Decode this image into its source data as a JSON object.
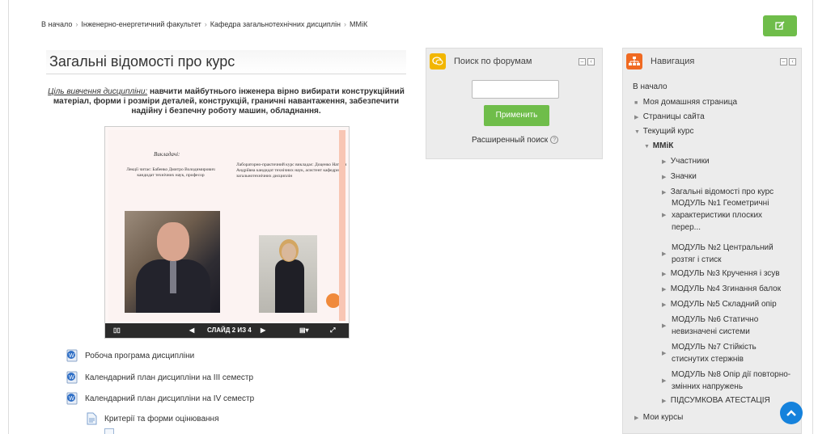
{
  "breadcrumb": [
    "В начало",
    "Інженерно-енергетичний факультет",
    "Кафедра загальнотехнічних дисциплін",
    "ММіК"
  ],
  "colors": {
    "accent_green": "#6fbd4a",
    "nav_orange": "#f06a22",
    "search_yellow": "#f2b600",
    "scroll_blue": "#1582dc"
  },
  "main": {
    "title": "Загальні відомості про курс",
    "intro_lead": "Ціль вивчення дисципліни:",
    "intro_text": " навчити майбутнього інженера вірно вибирати конструкційний матеріал, форми і розміри деталей, конструкцій, граничні навантаження, забезпечити надійну і безпечну роботу машин, обладнання.",
    "slide": {
      "heading": "Викладачі:",
      "left_text": "Лекції читає: Бабенко Дмитро Володимирович кандидат технічних наук, професор",
      "right_text": "Лабораторно-практичний курс викладає: Доценко Наталія Андріївна кандидат технічних наук, асистент кафедри загальнотехнічних дисциплін",
      "counter": "СЛАЙД 2 ИЗ 4"
    },
    "resources": [
      "Робоча програма дисципліни",
      "Календарний план дисципліни на ІІІ семестр",
      "Календарний план дисципліни на IV семестр",
      "Критерії та форми оцінювання"
    ]
  },
  "search_block": {
    "title": "Поиск по форумам",
    "input_value": "",
    "apply_label": "Применить",
    "advanced_label": "Расширенный поиск"
  },
  "nav_block": {
    "title": "Навигация",
    "home": "В начало",
    "my_home": "Моя домашняя страница",
    "site_pages": "Страницы сайта",
    "current_course": "Текущий курс",
    "course": "ММіК",
    "course_items": [
      "Участники",
      "Значки",
      "Загальні відомості про курс",
      "МОДУЛЬ №1 Геометричні характеристики плоских перер...",
      "МОДУЛЬ №2 Центральний розтяг і стиск",
      "МОДУЛЬ №3 Кручення і зсув",
      "МОДУЛЬ №4 Згинання балок",
      "МОДУЛЬ №5 Складний опір",
      "МОДУЛЬ №6 Статично невизначені системи",
      "МОДУЛЬ №7 Стійкість стиснутих стержнів",
      "МОДУЛЬ №8 Опір дії повторно-змінних напружень",
      "ПІДСУМКОВА АТЕСТАЦІЯ"
    ],
    "my_courses": "Мои курсы"
  }
}
